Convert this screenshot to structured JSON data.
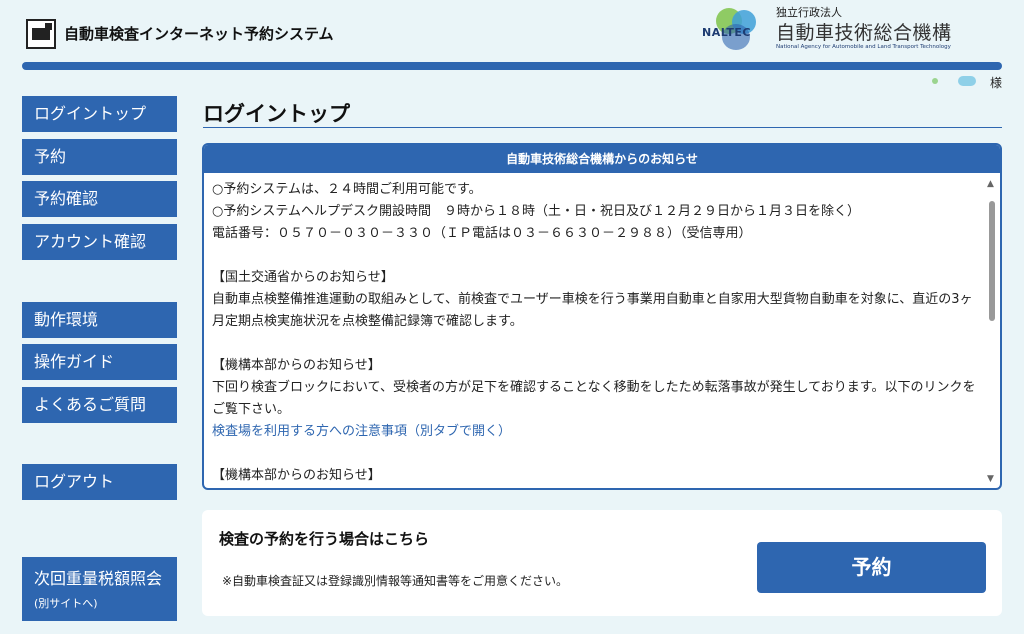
{
  "header": {
    "system_title": "自動車検査インターネット予約システム",
    "org_logo": {
      "word": "NALTEC",
      "small_label": "独立行政法人",
      "main_name": "自動車技術総合機構",
      "english_name": "National Agency for Automobile and Land Transport Technology"
    },
    "user_suffix": "様"
  },
  "sidebar": {
    "items": [
      {
        "label": "ログイントップ"
      },
      {
        "label": "予約"
      },
      {
        "label": "予約確認"
      },
      {
        "label": "アカウント確認"
      },
      {
        "label": "動作環境"
      },
      {
        "label": "操作ガイド"
      },
      {
        "label": "よくあるご質問"
      },
      {
        "label": "ログアウト"
      },
      {
        "label": "次回重量税額照会",
        "sub": "(別サイトへ)"
      }
    ]
  },
  "main": {
    "page_title": "ログイントップ",
    "notice": {
      "header": "自動車技術総合機構からのお知らせ",
      "lines": [
        "○予約システムは、２４時間ご利用可能です。",
        "○予約システムヘルプデスク開設時間　９時から１８時（土・日・祝日及び１２月２９日から１月３日を除く）",
        "電話番号：０５７０－０３０－３３０（ＩＰ電話は０３－６６３０－２９８８）（受信専用）",
        "【国土交通省からのお知らせ】",
        "自動車点検整備推進運動の取組みとして、前検査でユーザー車検を行う事業用自動車と自家用大型貨物自動車を対象に、直近の3ヶ月定期点検実施状況を点検整備記録簿で確認します。",
        "【機構本部からのお知らせ】",
        "下回り検査ブロックにおいて、受検者の方が足下を確認することなく移動をしたため転落事故が発生しております。以下のリンクをご覧下さい。",
        "検査場を利用する方への注意事項（別タブで開く）",
        "【機構本部からのお知らせ】"
      ]
    },
    "reserve": {
      "title": "検査の予約を行う場合はこちら",
      "note": "※自動車検査証又は登録識別情報等通知書等をご用意ください。",
      "button_label": "予約"
    }
  },
  "colors": {
    "accent": "#2e66b0",
    "background": "#eaf5f8"
  }
}
